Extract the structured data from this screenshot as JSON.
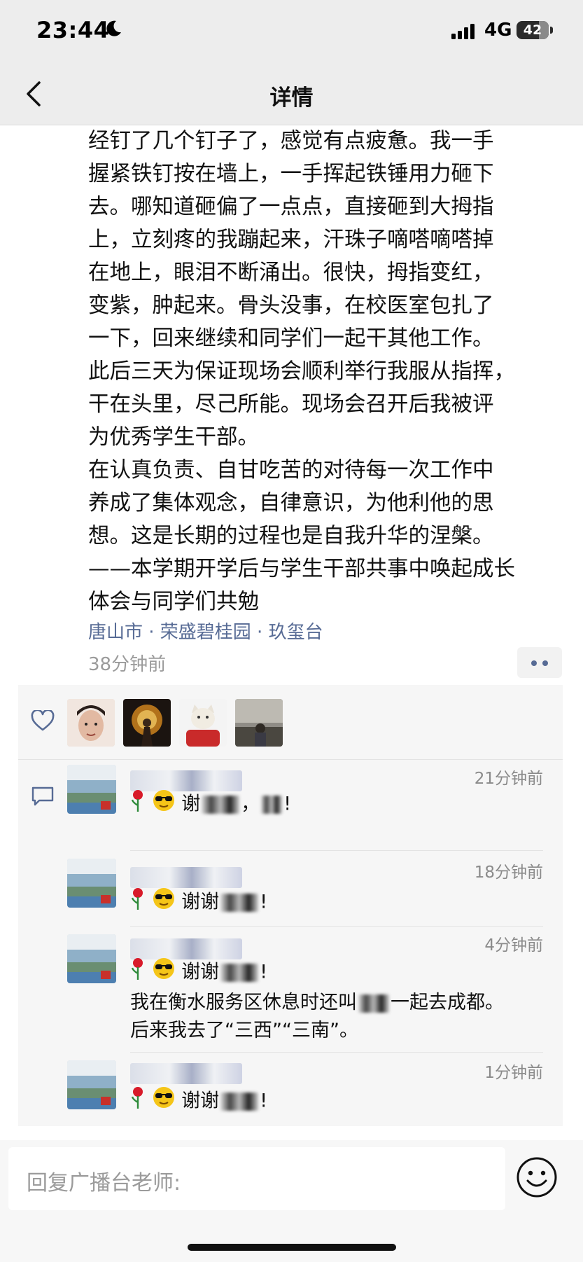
{
  "status_bar": {
    "time": "23:44",
    "network": "4G",
    "battery": "42"
  },
  "nav": {
    "title": "详情"
  },
  "post": {
    "paragraphs": [
      "经钉了几个钉子了，感觉有点疲惫。我一手\n握紧铁钉按在墙上，一手挥起铁锤用力砸下\n去。哪知道砸偏了一点点，直接砸到大拇指\n上，立刻疼的我蹦起来，汗珠子嘀嗒嘀嗒掉\n在地上，眼泪不断涌出。很快，拇指变红，\n变紫，肿起来。骨头没事，在校医室包扎了\n一下，回来继续和同学们一起干其他工作。\n此后三天为保证现场会顺利举行我服从指挥，\n干在头里，尽己所能。现场会召开后我被评\n为优秀学生干部。",
      "在认真负责、自甘吃苦的对待每一次工作中\n养成了集体观念，自律意识，为他利他的思\n想。这是长期的过程也是自我升华的涅槃。\n——本学期开学后与学生干部共事中唤起成长\n体会与同学们共勉"
    ],
    "location": "唐山市 · 荣盛碧桂园 · 玖玺台",
    "time_ago": "38分钟前"
  },
  "likes": {
    "avatars": [
      "avatar-young-man",
      "avatar-fire-figure",
      "avatar-cat",
      "avatar-landscape-man"
    ]
  },
  "comments": [
    {
      "time": "21分钟前",
      "pre": "谢",
      "mid": "，",
      "post": "!"
    },
    {
      "time": "18分钟前",
      "pre": "谢谢",
      "post": "!"
    },
    {
      "time": "4分钟前",
      "pre": "谢谢",
      "post": "!",
      "line2": "我在衡水服务区休息时还叫",
      "line2b": "一起去成都。",
      "line3": "后来我去了“三西”“三南”。"
    },
    {
      "time": "1分钟前",
      "pre": "谢谢",
      "post": "!"
    }
  ],
  "reply": {
    "placeholder": "回复广播台老师:"
  },
  "colors": {
    "link": "#576b95",
    "panel": "#f6f6f6",
    "nav": "#ededed"
  }
}
